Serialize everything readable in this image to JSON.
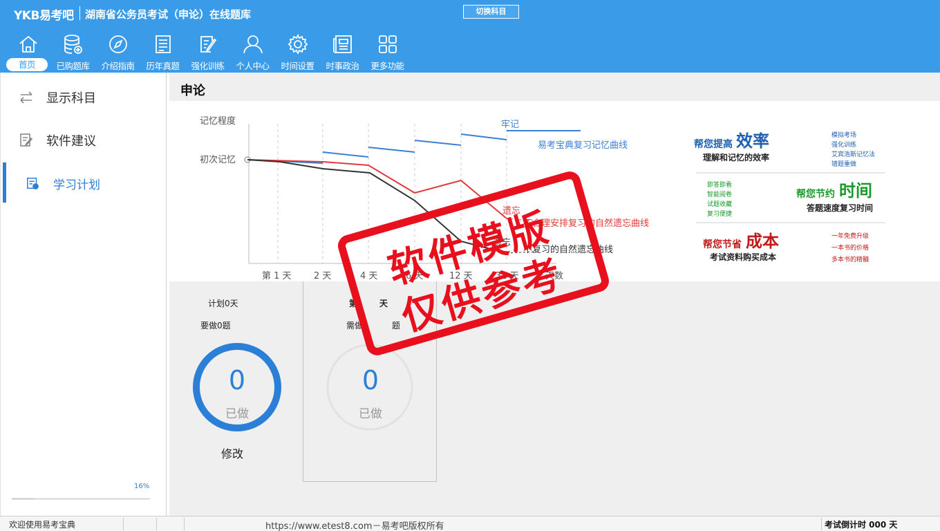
{
  "header": {
    "brand": "YKB易考吧",
    "title": "湖南省公务员考试（申论）在线题库",
    "switch_label": "切换科目",
    "bg_color": "#3a9be8"
  },
  "nav": [
    {
      "label": "首页",
      "icon": "home-icon",
      "active": true
    },
    {
      "label": "已购题库",
      "icon": "database-icon"
    },
    {
      "label": "介绍指南",
      "icon": "compass-icon"
    },
    {
      "label": "历年真题",
      "icon": "list-icon"
    },
    {
      "label": "强化训练",
      "icon": "edit-icon"
    },
    {
      "label": "个人中心",
      "icon": "user-icon"
    },
    {
      "label": "时间设置",
      "icon": "gear-icon"
    },
    {
      "label": "时事政治",
      "icon": "news-icon"
    },
    {
      "label": "更多功能",
      "icon": "grid-icon"
    }
  ],
  "sidebar": {
    "items": [
      {
        "label": "显示科目",
        "icon": "swap-icon"
      },
      {
        "label": "软件建议",
        "icon": "note-icon"
      },
      {
        "label": "学习计划",
        "icon": "plan-icon",
        "active": true
      }
    ],
    "progress": {
      "label": "16%",
      "value": 0.16
    }
  },
  "main": {
    "title": "申论",
    "chart": {
      "y_labels": [
        "记忆程度",
        "初次记忆"
      ],
      "x_labels": [
        "第 1 天",
        "2 天",
        "4 天",
        "6 天",
        "12 天",
        "31 天",
        "天数"
      ],
      "annotations": {
        "firm": "牢记",
        "blue_line": "易考宝典复习记忆曲线",
        "forget": "遗忘",
        "red_line": "不合理安排复习的自然遗忘曲线",
        "forget2": "遗忘",
        "black_line": "不复习的自然遗忘曲线"
      },
      "colors": {
        "blue": "#3a7fd6",
        "red": "#e23a3a",
        "black": "#333333"
      }
    },
    "promo": {
      "efficiency": {
        "prefix": "帮您提高",
        "big": "效率",
        "sub": "理解和记忆的效率",
        "items": [
          "模拟考场",
          "强化训练",
          "艾宾浩斯记忆法",
          "错题重做"
        ],
        "color": "#2060b0"
      },
      "time": {
        "prefix": "帮您节约",
        "big": "时间",
        "sub": "答题速度复习时间",
        "items": [
          "即答即看",
          "智能阅卷",
          "试题收藏",
          "复习便捷"
        ],
        "color": "#1a9a2a"
      },
      "cost": {
        "prefix": "帮您节省",
        "big": "成本",
        "sub": "考试资料购买成本",
        "items": [
          "一年免费升级",
          "一本书的价格",
          "多本书的精髓"
        ],
        "color": "#c01a1a"
      }
    },
    "plan_card": {
      "plan": "计划0天",
      "todo": "要做0题",
      "count": "0",
      "done_label": "已做",
      "modify": "修改",
      "ring_color": "#2b7fd6"
    },
    "day_card": {
      "day_a": "第",
      "day_b": "天",
      "need_a": "需做",
      "need_b": "题",
      "count": "0",
      "done_label": "已做"
    }
  },
  "stamp": {
    "line1": "软件模版",
    "line2": "仅供参考",
    "color": "#e8101c"
  },
  "status": {
    "left": "欢迎使用易考宝典",
    "center": "https://www.etest8.com－易考吧版权所有",
    "right": "考试倒计时 000 天"
  }
}
